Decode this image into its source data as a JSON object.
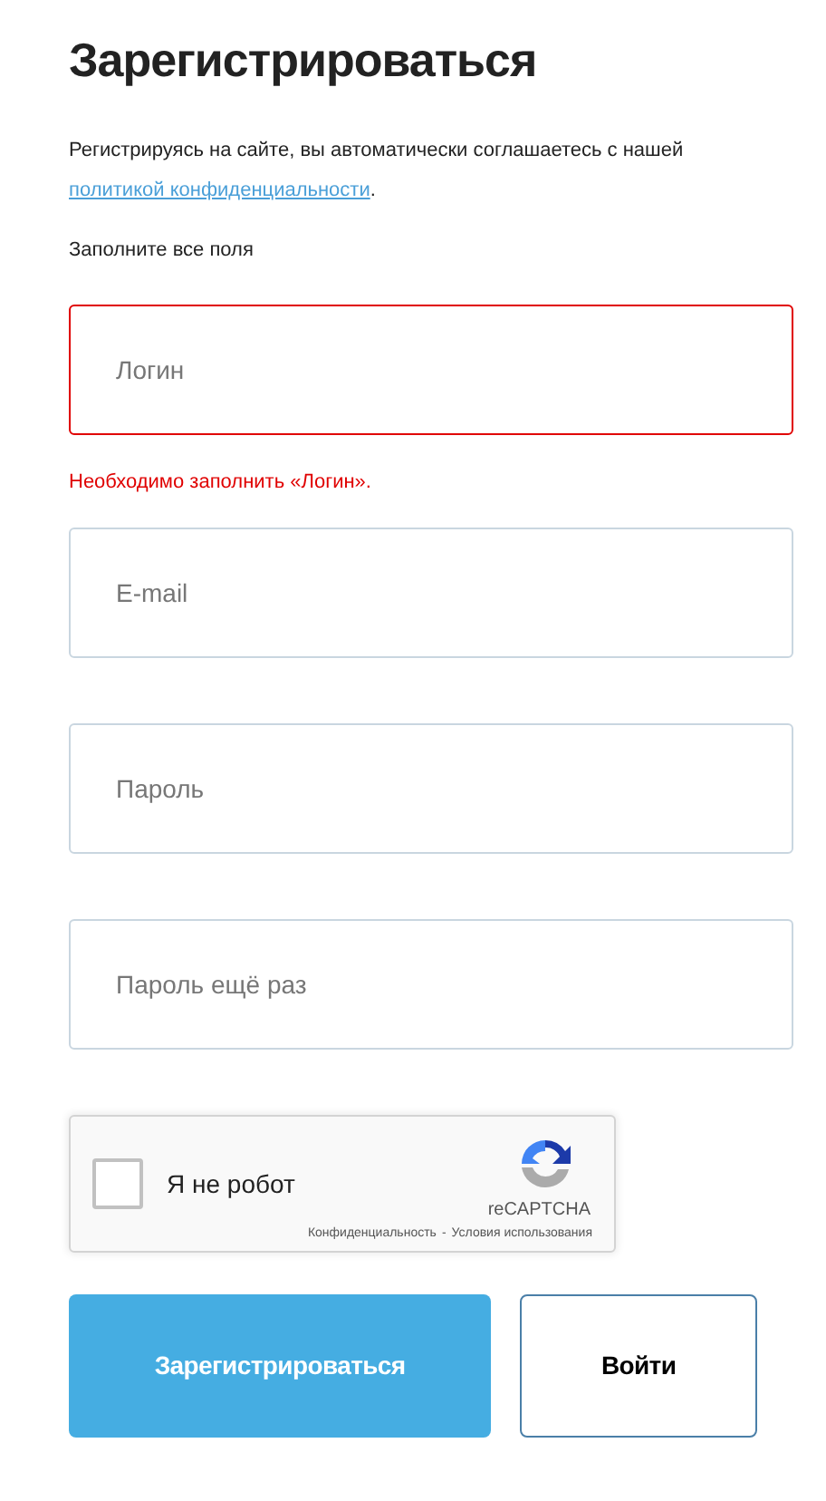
{
  "title": "Зарегистрироваться",
  "consent": {
    "text": "Регистрируясь на сайте, вы автоматически соглашаетесь с нашей",
    "link": "политикой конфиденциальности",
    "end": "."
  },
  "hint": "Заполните все поля",
  "fields": [
    {
      "placeholder": "Логин",
      "invalid": true,
      "error": "Необходимо заполнить «Логин»."
    },
    {
      "placeholder": "E-mail",
      "invalid": false
    },
    {
      "placeholder": "Пароль",
      "invalid": false
    },
    {
      "placeholder": "Пароль ещё раз",
      "invalid": false
    }
  ],
  "captcha": {
    "label": "Я не робот",
    "checked": false,
    "brand": "reCAPTCHA",
    "privacy": "Конфиденциальность",
    "separator": "-",
    "terms": "Условия использования"
  },
  "buttons": [
    {
      "label": "Зарегистрироваться",
      "kind": "primary"
    },
    {
      "label": "Войти",
      "kind": "secondary"
    }
  ]
}
